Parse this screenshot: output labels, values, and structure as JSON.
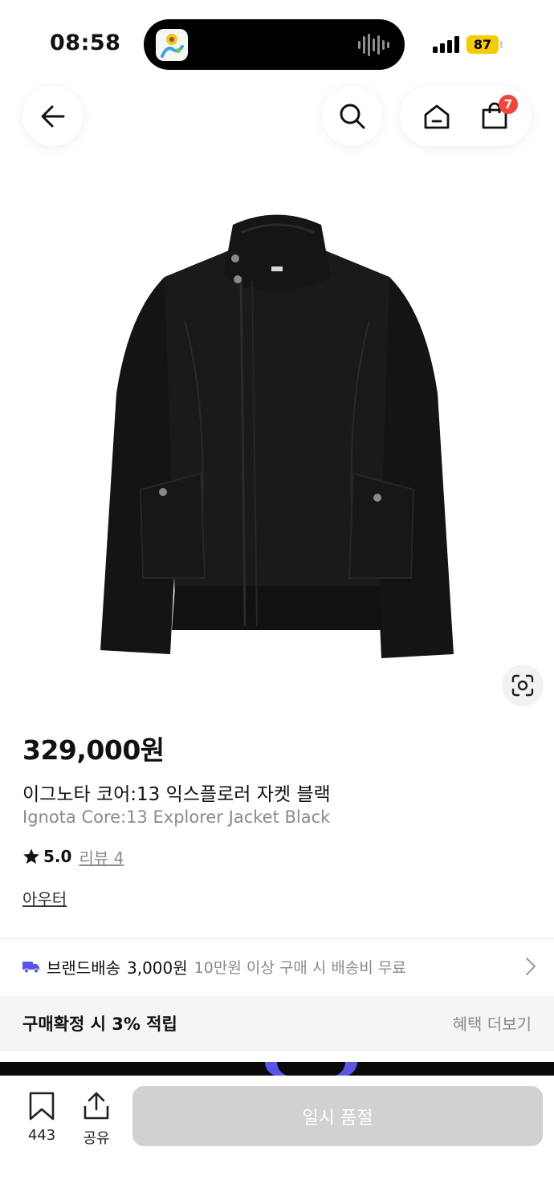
{
  "status_bar": {
    "time": "08:58",
    "battery": "87"
  },
  "nav": {
    "cart_count": "7"
  },
  "product": {
    "price": "329,000원",
    "name_ko": "이그노타 코어:13 익스플로러 자켓 블랙",
    "name_en": "Ignota Core:13 Explorer Jacket Black",
    "rating": "5.0",
    "review_label": "리뷰 4",
    "category": "아우터"
  },
  "shipping": {
    "label": "브랜드배송",
    "price": "3,000원",
    "note": "10만원 이상 구매 시 배송비 무료"
  },
  "benefit": {
    "text": "구매확정 시 3% 적립",
    "more": "혜택 더보기"
  },
  "bottom_bar": {
    "bookmark_count": "443",
    "share_label": "공유",
    "soldout_label": "일시 품절"
  },
  "colors": {
    "cart_badge": "#f2453d",
    "battery": "#f5cc00",
    "truck_icon": "#5b54e8",
    "button_disabled": "#d1d1d1"
  }
}
